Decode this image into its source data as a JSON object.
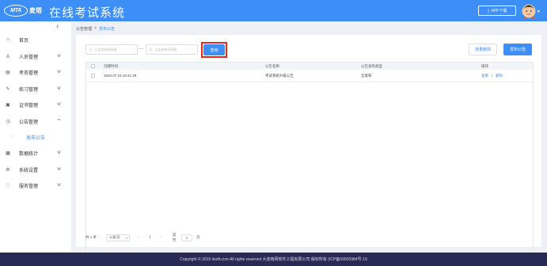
{
  "header": {
    "logo_badge": "MTA",
    "logo_text": "麦塔",
    "title": "在线考试系统",
    "app_download": "APP下载",
    "avatar_icon": "user-avatar-icon",
    "brand_color": "#3e8ef7"
  },
  "sidebar": {
    "items": [
      {
        "label": "首页",
        "icon": "home-icon"
      },
      {
        "label": "人员管理",
        "icon": "user-icon"
      },
      {
        "label": "考务管理",
        "icon": "exam-icon"
      },
      {
        "label": "练习管理",
        "icon": "edit-icon"
      },
      {
        "label": "证书管理",
        "icon": "certificate-icon"
      },
      {
        "label": "公告管理",
        "icon": "notice-icon"
      },
      {
        "label": "发布公告",
        "icon": "publish-icon"
      },
      {
        "label": "数据统计",
        "icon": "stats-icon"
      },
      {
        "label": "系统设置",
        "icon": "settings-icon"
      },
      {
        "label": "服务管理",
        "icon": "service-icon"
      }
    ]
  },
  "breadcrumb": {
    "parent": "公告管理",
    "separator": ">",
    "current": "发布公告"
  },
  "filters": {
    "start_placeholder": "公告发布时间段",
    "end_placeholder": "公告发布时间段",
    "separator": "—",
    "query_button": "查询",
    "batch_delete_button": "批量删除",
    "publish_button": "发布公告"
  },
  "table": {
    "columns": [
      "创建时间",
      "公告名称",
      "公告发布类型",
      "操作"
    ],
    "rows": [
      {
        "created": "2020.07.15 16:41:29",
        "name": "考试系统升级公告",
        "type": "全发布",
        "action_view": "查看",
        "action_sep": "|",
        "action_delete": "删除"
      }
    ]
  },
  "pagination": {
    "total": "共 1 条",
    "page_size": "10条/页",
    "current_page": "1",
    "goto_label": "前往",
    "goto_value": "1",
    "page_suffix": "页"
  },
  "footer": {
    "text": "Copyright © 2019 itsoft.com All rights reserved 大连格网软件工程有限公司 版权所有 (ICP备09020984号-19"
  }
}
